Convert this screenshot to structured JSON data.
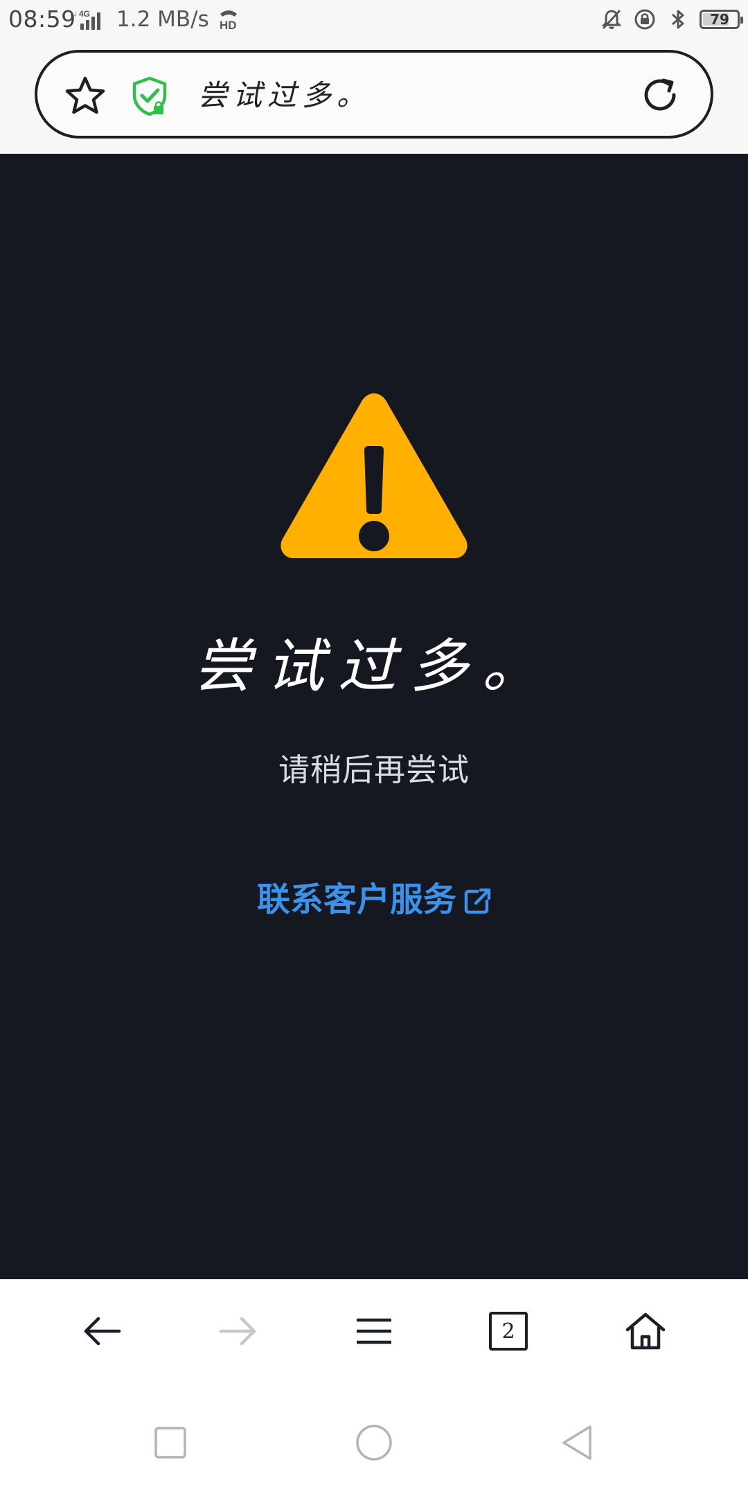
{
  "status_bar": {
    "time": "08:59",
    "network_label": "4G",
    "speed": "1.2 MB/s",
    "hd_label": "HD",
    "battery": "79",
    "battery_level": 0.79,
    "icons": [
      "network-signal-icon",
      "hd-voice-icon",
      "mute-icon",
      "rotation-lock-icon",
      "bluetooth-icon",
      "battery-icon"
    ]
  },
  "address_bar": {
    "title": "尝试过多。",
    "star_icon": "star-icon",
    "security_icon": "shield-check-icon",
    "reload_icon": "reload-icon",
    "security_color": "#2fbf4a"
  },
  "error": {
    "title": "尝试过多。",
    "subtitle": "请稍后再尝试",
    "link_label": "联系客户服务",
    "link_icon": "external-link-icon",
    "warning_icon": "warning-triangle-icon",
    "warning_color": "#ffb000",
    "background_color": "#151820",
    "link_color": "#3b92ea"
  },
  "toolbar": {
    "tab_count": "2",
    "buttons": [
      "back-arrow-icon",
      "forward-arrow-icon",
      "menu-icon",
      "tabs-icon",
      "home-icon"
    ]
  },
  "navbar": {
    "buttons": [
      "recent-apps-icon",
      "home-circle-icon",
      "back-triangle-icon"
    ]
  }
}
